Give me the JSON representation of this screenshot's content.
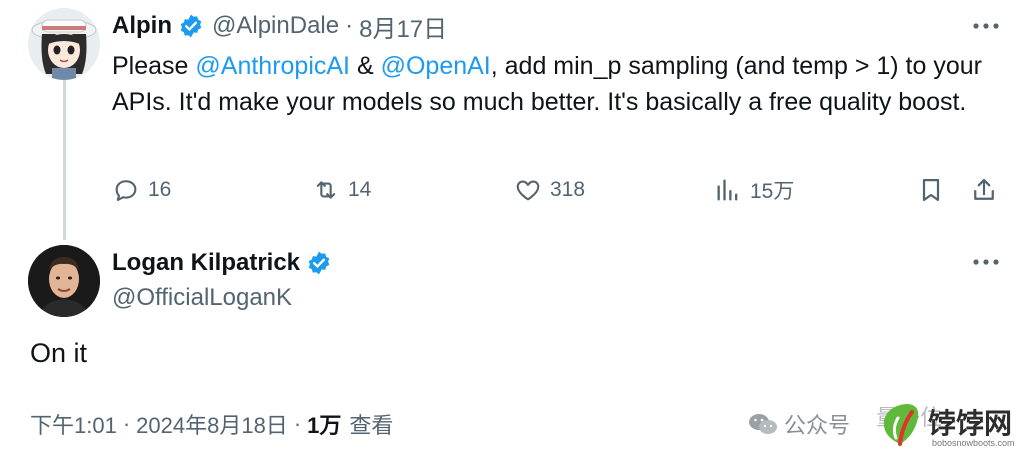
{
  "tweet": {
    "author": {
      "name": "Alpin",
      "handle": "@AlpinDale",
      "date": "8月17日",
      "separator": "·"
    },
    "text": {
      "part1": "Please ",
      "mention1": "@AnthropicAI",
      "part2": " & ",
      "mention2": "@OpenAI",
      "part3": ", add min_p sampling (and temp > 1) to your APIs. It'd make your models so much better. It's basically a free quality boost."
    },
    "actions": {
      "replies": "16",
      "retweets": "14",
      "likes": "318",
      "views": "15万"
    }
  },
  "reply": {
    "author": {
      "name": "Logan Kilpatrick",
      "handle": "@OfficialLoganK"
    },
    "text": "On it",
    "meta": {
      "time": "下午1:01",
      "date": "2024年8月18日",
      "views_count": "1万",
      "views_label": "查看",
      "separator": "·"
    }
  },
  "watermark": {
    "wechat_label": "公众号",
    "faint_text": "量子位",
    "site_name": "饽饽网",
    "site_domain": "bobosnowboots.com"
  },
  "colors": {
    "accent": "#1d9bf0",
    "text": "#0f1419",
    "muted": "#536471",
    "line": "#cfd9de"
  },
  "icons": [
    "more-icon",
    "verified-badge-icon",
    "reply-icon",
    "retweet-icon",
    "like-icon",
    "views-icon",
    "bookmark-icon",
    "share-icon",
    "wechat-icon",
    "leaf-logo-icon"
  ]
}
